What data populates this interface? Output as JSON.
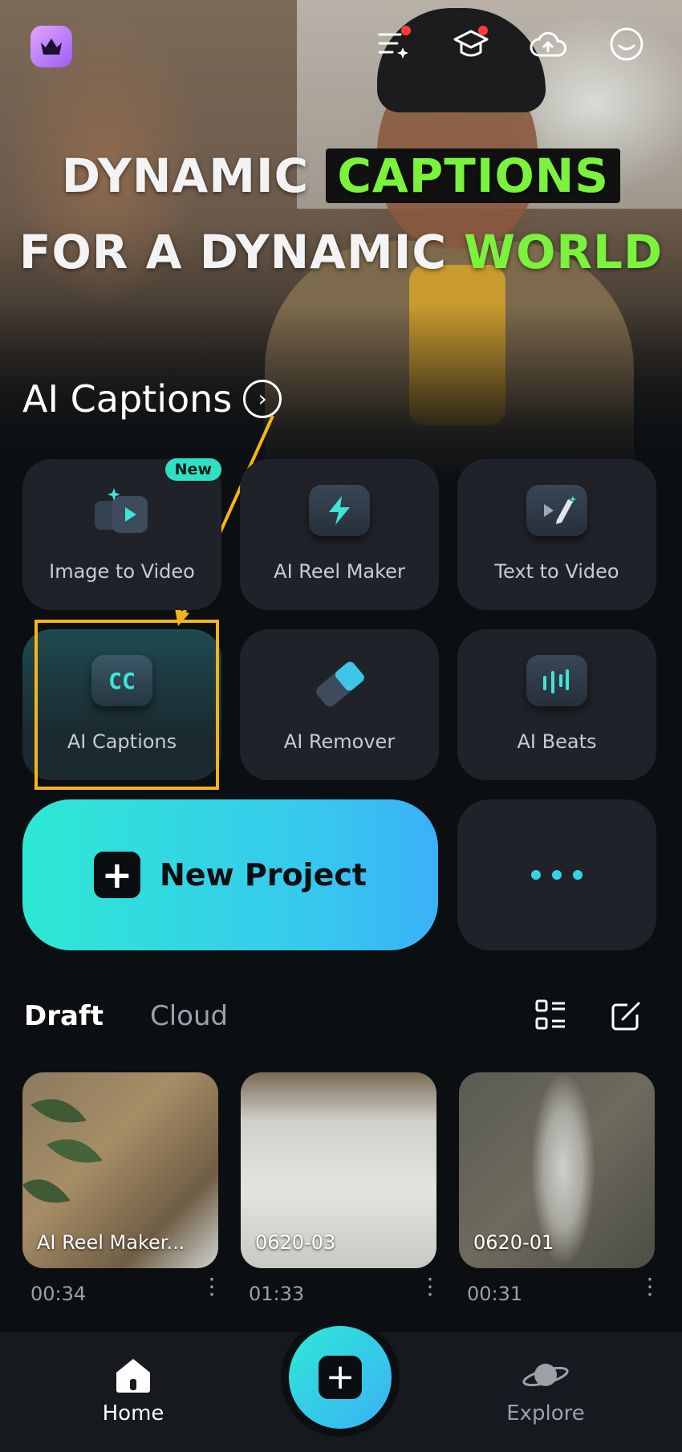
{
  "header": {
    "icons": [
      "crown-icon",
      "task-list-icon",
      "academy-icon",
      "cloud-icon",
      "profile-icon"
    ],
    "headline_line1_part1": "DYNAMIC",
    "headline_line1_part2": "CAPTIONS",
    "headline_line2_part1": "FOR A DYNAMIC",
    "headline_line2_part2": "WORLD",
    "section_title": "AI Captions"
  },
  "tools": [
    {
      "label": "Image to Video",
      "badge": "New",
      "icon": "image-to-video-icon"
    },
    {
      "label": "AI Reel Maker",
      "icon": "lightning-icon"
    },
    {
      "label": "Text to Video",
      "icon": "pencil-video-icon"
    },
    {
      "label": "AI Captions",
      "icon": "cc-icon"
    },
    {
      "label": "AI Remover",
      "icon": "eraser-icon"
    },
    {
      "label": "AI Beats",
      "icon": "music-beats-icon"
    }
  ],
  "new_project": {
    "label": "New Project"
  },
  "tabs": {
    "draft": "Draft",
    "cloud": "Cloud"
  },
  "drafts": [
    {
      "title": "AI Reel Maker...",
      "duration": "00:34"
    },
    {
      "title": "0620-03",
      "duration": "01:33"
    },
    {
      "title": "0620-01",
      "duration": "00:31"
    }
  ],
  "bottom_nav": {
    "home": "Home",
    "explore": "Explore"
  },
  "colors": {
    "accent": "#2de9d4",
    "highlight": "#f5b417",
    "headline_green": "#7bf23b"
  }
}
